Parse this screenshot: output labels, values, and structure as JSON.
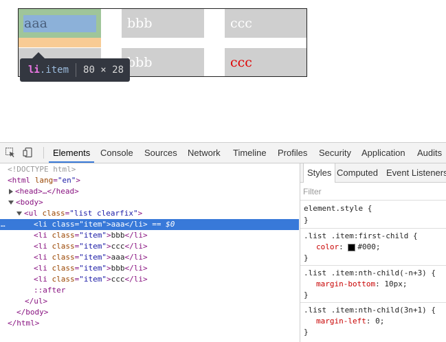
{
  "preview": {
    "row1": [
      "aaa",
      "bbb",
      "ccc"
    ],
    "row2": [
      "aaa",
      "bbb",
      "ccc"
    ],
    "colors": {
      "margin": "#f8cb94",
      "padding": "#9fc59a",
      "content": "#8cb1d9",
      "cell": "#cfcfcf",
      "red_text": "#e00000"
    }
  },
  "tooltip": {
    "tag": "li",
    "class": ".item",
    "size": "80 × 28"
  },
  "toolbar": {
    "icons": [
      "inspect-icon",
      "device-mode-icon"
    ],
    "tabs": [
      "Elements",
      "Console",
      "Sources",
      "Network",
      "Timeline",
      "Profiles",
      "Security",
      "Application",
      "Audits"
    ],
    "active": "Elements"
  },
  "dom": {
    "doctype": "<!DOCTYPE html>",
    "html_open": "<html",
    "html_attr": "lang",
    "html_val": "\"en\"",
    "html_close_br": ">",
    "head": "<head>…</head>",
    "body_open": "<body>",
    "ul_open": "<ul",
    "ul_attr": "class",
    "ul_val": "\"list clearfix\"",
    "ul_close_br": ">",
    "li_open": "<li",
    "li_attr": "class",
    "li_val": "\"item\"",
    "li_close_br": ">",
    "li_end": "</li>",
    "items": [
      "aaa",
      "bbb",
      "ccc",
      "aaa",
      "bbb",
      "ccc"
    ],
    "selected_suffix": " == $0",
    "after": "::after",
    "ul_end": "</ul>",
    "body_end": "</body>",
    "html_end": "</html>",
    "dots": "…"
  },
  "styles": {
    "tabs": [
      "Styles",
      "Computed",
      "Event Listeners"
    ],
    "filter_placeholder": "Filter",
    "rules": [
      {
        "selector": "element.style {",
        "props": [],
        "close": "}"
      },
      {
        "selector": ".list .item:first-child {",
        "props": [
          {
            "name": "color",
            "value": "#000;",
            "swatch": "#000000"
          }
        ],
        "close": "}"
      },
      {
        "selector": ".list .item:nth-child(-n+3) {",
        "props": [
          {
            "name": "margin-bottom",
            "value": "10px;"
          }
        ],
        "close": "}"
      },
      {
        "selector": ".list .item:nth-child(3n+1) {",
        "props": [
          {
            "name": "margin-left",
            "value": "0;"
          }
        ],
        "close": "}"
      }
    ]
  }
}
